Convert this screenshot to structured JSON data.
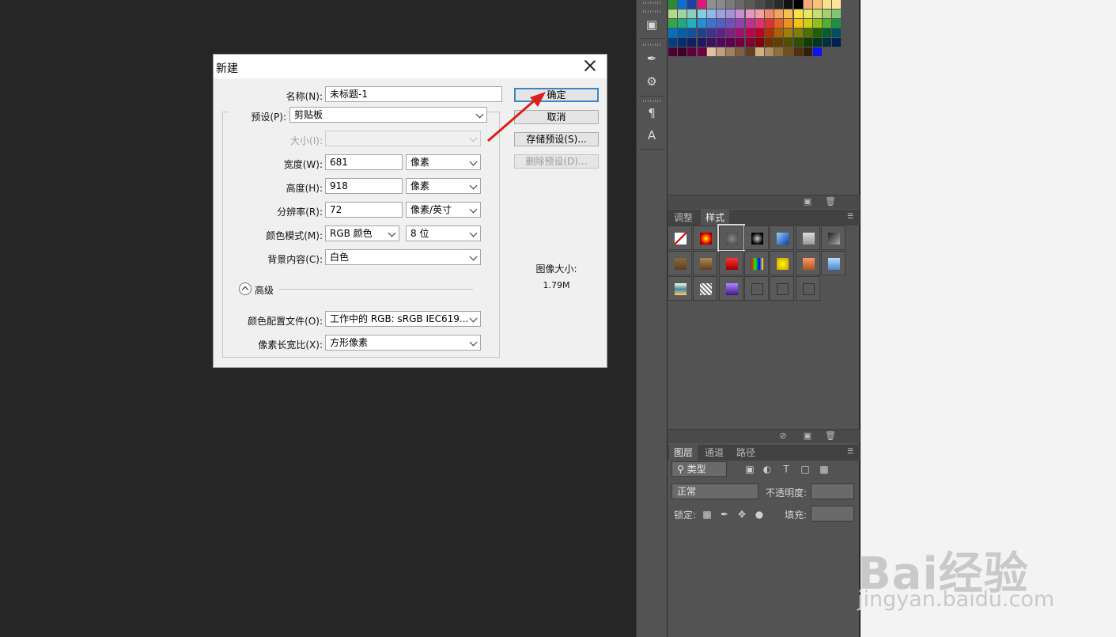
{
  "dialog": {
    "title": "新建",
    "fields": {
      "name_label": "名称(N):",
      "name_value": "未标题-1",
      "preset_label": "预设(P):",
      "preset_value": "剪贴板",
      "size_label": "大小(I):",
      "size_value": "",
      "width_label": "宽度(W):",
      "width_value": "681",
      "width_unit": "像素",
      "height_label": "高度(H):",
      "height_value": "918",
      "height_unit": "像素",
      "resolution_label": "分辨率(R):",
      "resolution_value": "72",
      "resolution_unit": "像素/英寸",
      "color_mode_label": "颜色模式(M):",
      "color_mode_value": "RGB 颜色",
      "bit_depth": "8 位",
      "background_label": "背景内容(C):",
      "background_value": "白色",
      "advanced_label": "高级",
      "profile_label": "颜色配置文件(O):",
      "profile_value": "工作中的 RGB: sRGB IEC619...",
      "aspect_label": "像素长宽比(X):",
      "aspect_value": "方形像素"
    },
    "buttons": {
      "ok": "确定",
      "cancel": "取消",
      "save_preset": "存储预设(S)...",
      "delete_preset": "删除预设(D)..."
    },
    "image_size_label": "图像大小:",
    "image_size_value": "1.79M"
  },
  "styles_panel": {
    "tabs": [
      "调整",
      "样式"
    ],
    "active_tab": "样式"
  },
  "layers_panel": {
    "tabs": [
      "图层",
      "通道",
      "路径"
    ],
    "active_tab": "图层",
    "filter_label": "类型",
    "blend_mode": "正常",
    "opacity_label": "不透明度:",
    "lock_label": "锁定:",
    "fill_label": "填充:"
  },
  "watermark": {
    "logo": "Bai经验",
    "url": "jingyan.baidu.com"
  },
  "colors": {
    "accent": "#3d84c8",
    "annotation": "#d9201f",
    "panel_bg": "#535353",
    "workspace_bg": "#262626"
  }
}
